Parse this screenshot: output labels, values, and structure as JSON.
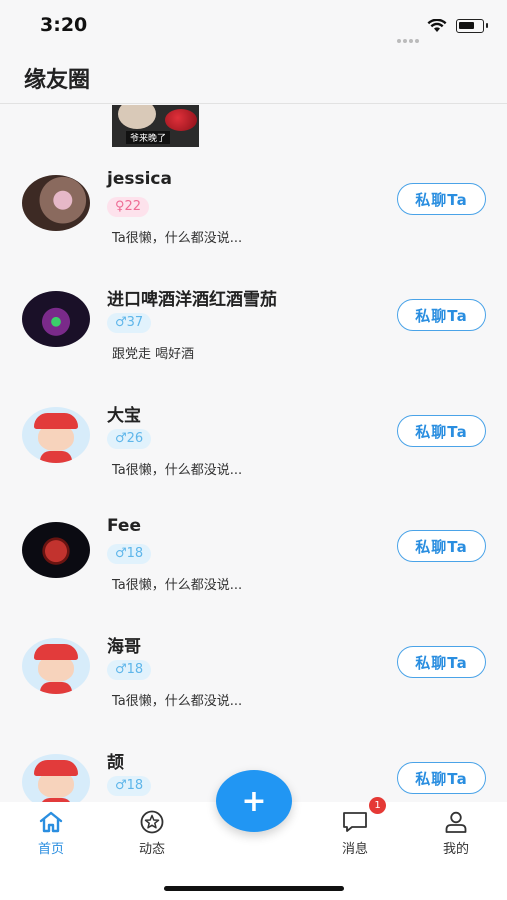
{
  "status_bar": {
    "time": "3:20"
  },
  "header": {
    "title": "缘友圈"
  },
  "partial_post": {
    "photo_caption": "爷来晚了"
  },
  "users": [
    {
      "name": "jessica",
      "gender_age": "♀22",
      "gender": "female",
      "bio": "Ta很懒，什么都没说...",
      "chat_label": "私聊Ta"
    },
    {
      "name": "进口啤酒洋酒红酒雪茄",
      "gender_age": "♂37",
      "gender": "male",
      "bio": "跟党走 喝好酒",
      "chat_label": "私聊Ta"
    },
    {
      "name": "大宝",
      "gender_age": "♂26",
      "gender": "male",
      "bio": "Ta很懒，什么都没说...",
      "chat_label": "私聊Ta"
    },
    {
      "name": "Fee",
      "gender_age": "♂18",
      "gender": "male",
      "bio": "Ta很懒，什么都没说...",
      "chat_label": "私聊Ta"
    },
    {
      "name": "海哥",
      "gender_age": "♂18",
      "gender": "male",
      "bio": "Ta很懒，什么都没说...",
      "chat_label": "私聊Ta"
    },
    {
      "name": "颉",
      "gender_age": "♂18",
      "gender": "male",
      "bio": "",
      "chat_label": "私聊Ta"
    }
  ],
  "tabbar": {
    "tabs": [
      {
        "label": "首页",
        "icon": "home-icon",
        "active": true
      },
      {
        "label": "动态",
        "icon": "star-icon",
        "active": false
      },
      {
        "label": "消息",
        "icon": "message-icon",
        "active": false
      },
      {
        "label": "我的",
        "icon": "person-icon",
        "active": false
      }
    ],
    "message_badge": "1",
    "fab_symbol": "+"
  },
  "colors": {
    "accent": "#2196f3",
    "female_badge": "#ee6b94",
    "male_badge": "#5fb6ea",
    "badge_red": "#e53935"
  }
}
